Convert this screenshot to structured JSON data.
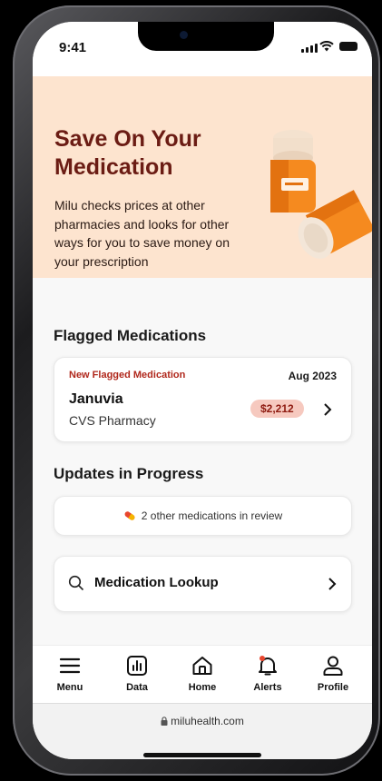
{
  "status": {
    "time": "9:41"
  },
  "hero": {
    "title": "Save On Your Medication",
    "body": "Milu checks prices at other pharmacies and looks for other ways for you to save money on your prescription",
    "icon": "pill-bottles-illustration"
  },
  "flagged": {
    "section_title": "Flagged Medications",
    "label": "New Flagged Medication",
    "date": "Aug 2023",
    "medication": "Januvia",
    "pharmacy": "CVS Pharmacy",
    "price": "$2,212"
  },
  "updates": {
    "section_title": "Updates in Progress",
    "review_text": "2 other medications in review"
  },
  "lookup": {
    "label": "Medication Lookup"
  },
  "tabs": [
    {
      "label": "Menu",
      "icon": "menu-icon"
    },
    {
      "label": "Data",
      "icon": "chart-icon"
    },
    {
      "label": "Home",
      "icon": "home-icon"
    },
    {
      "label": "Alerts",
      "icon": "bell-icon"
    },
    {
      "label": "Profile",
      "icon": "person-icon"
    }
  ],
  "browser": {
    "url": "miluhealth.com"
  },
  "colors": {
    "hero_bg": "#fde4cf",
    "hero_title": "#6b1c14",
    "flag_red": "#b0271b",
    "badge_bg": "#f6c9bf",
    "alert_dot": "#e8462e"
  }
}
